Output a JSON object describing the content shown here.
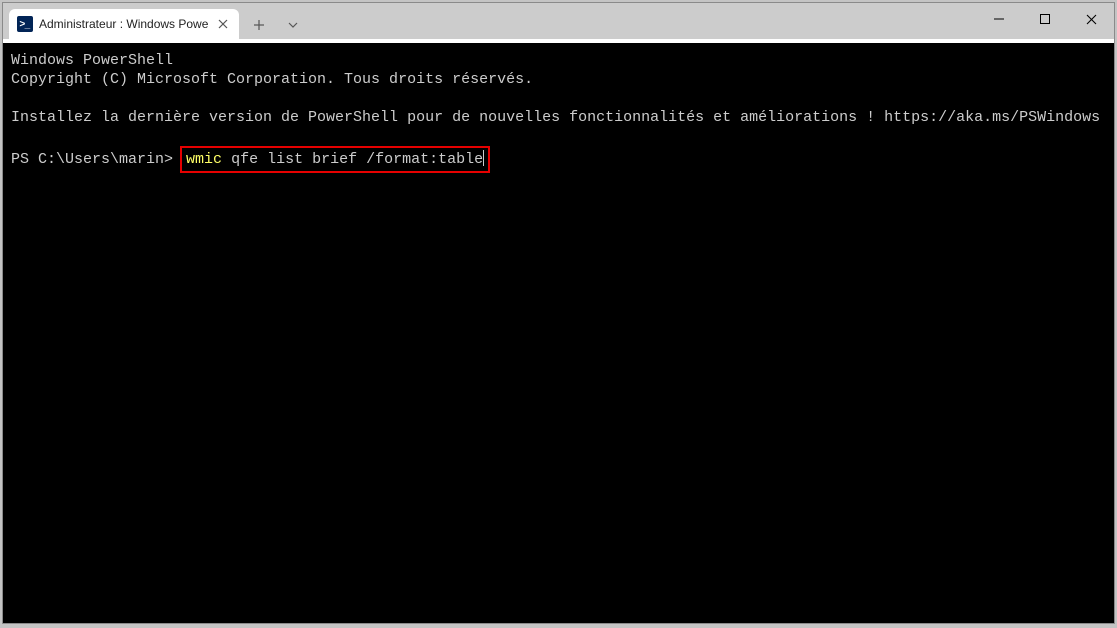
{
  "window": {
    "tab": {
      "title": "Administrateur : Windows Powe"
    }
  },
  "terminal": {
    "line1": "Windows PowerShell",
    "line2": "Copyright (C) Microsoft Corporation. Tous droits réservés.",
    "line3": "Installez la dernière version de PowerShell pour de nouvelles fonctionnalités et améliorations ! https://aka.ms/PSWindows",
    "prompt": "PS C:\\Users\\marin>",
    "command_keyword": "wmic",
    "command_rest": " qfe list brief /format:table"
  }
}
